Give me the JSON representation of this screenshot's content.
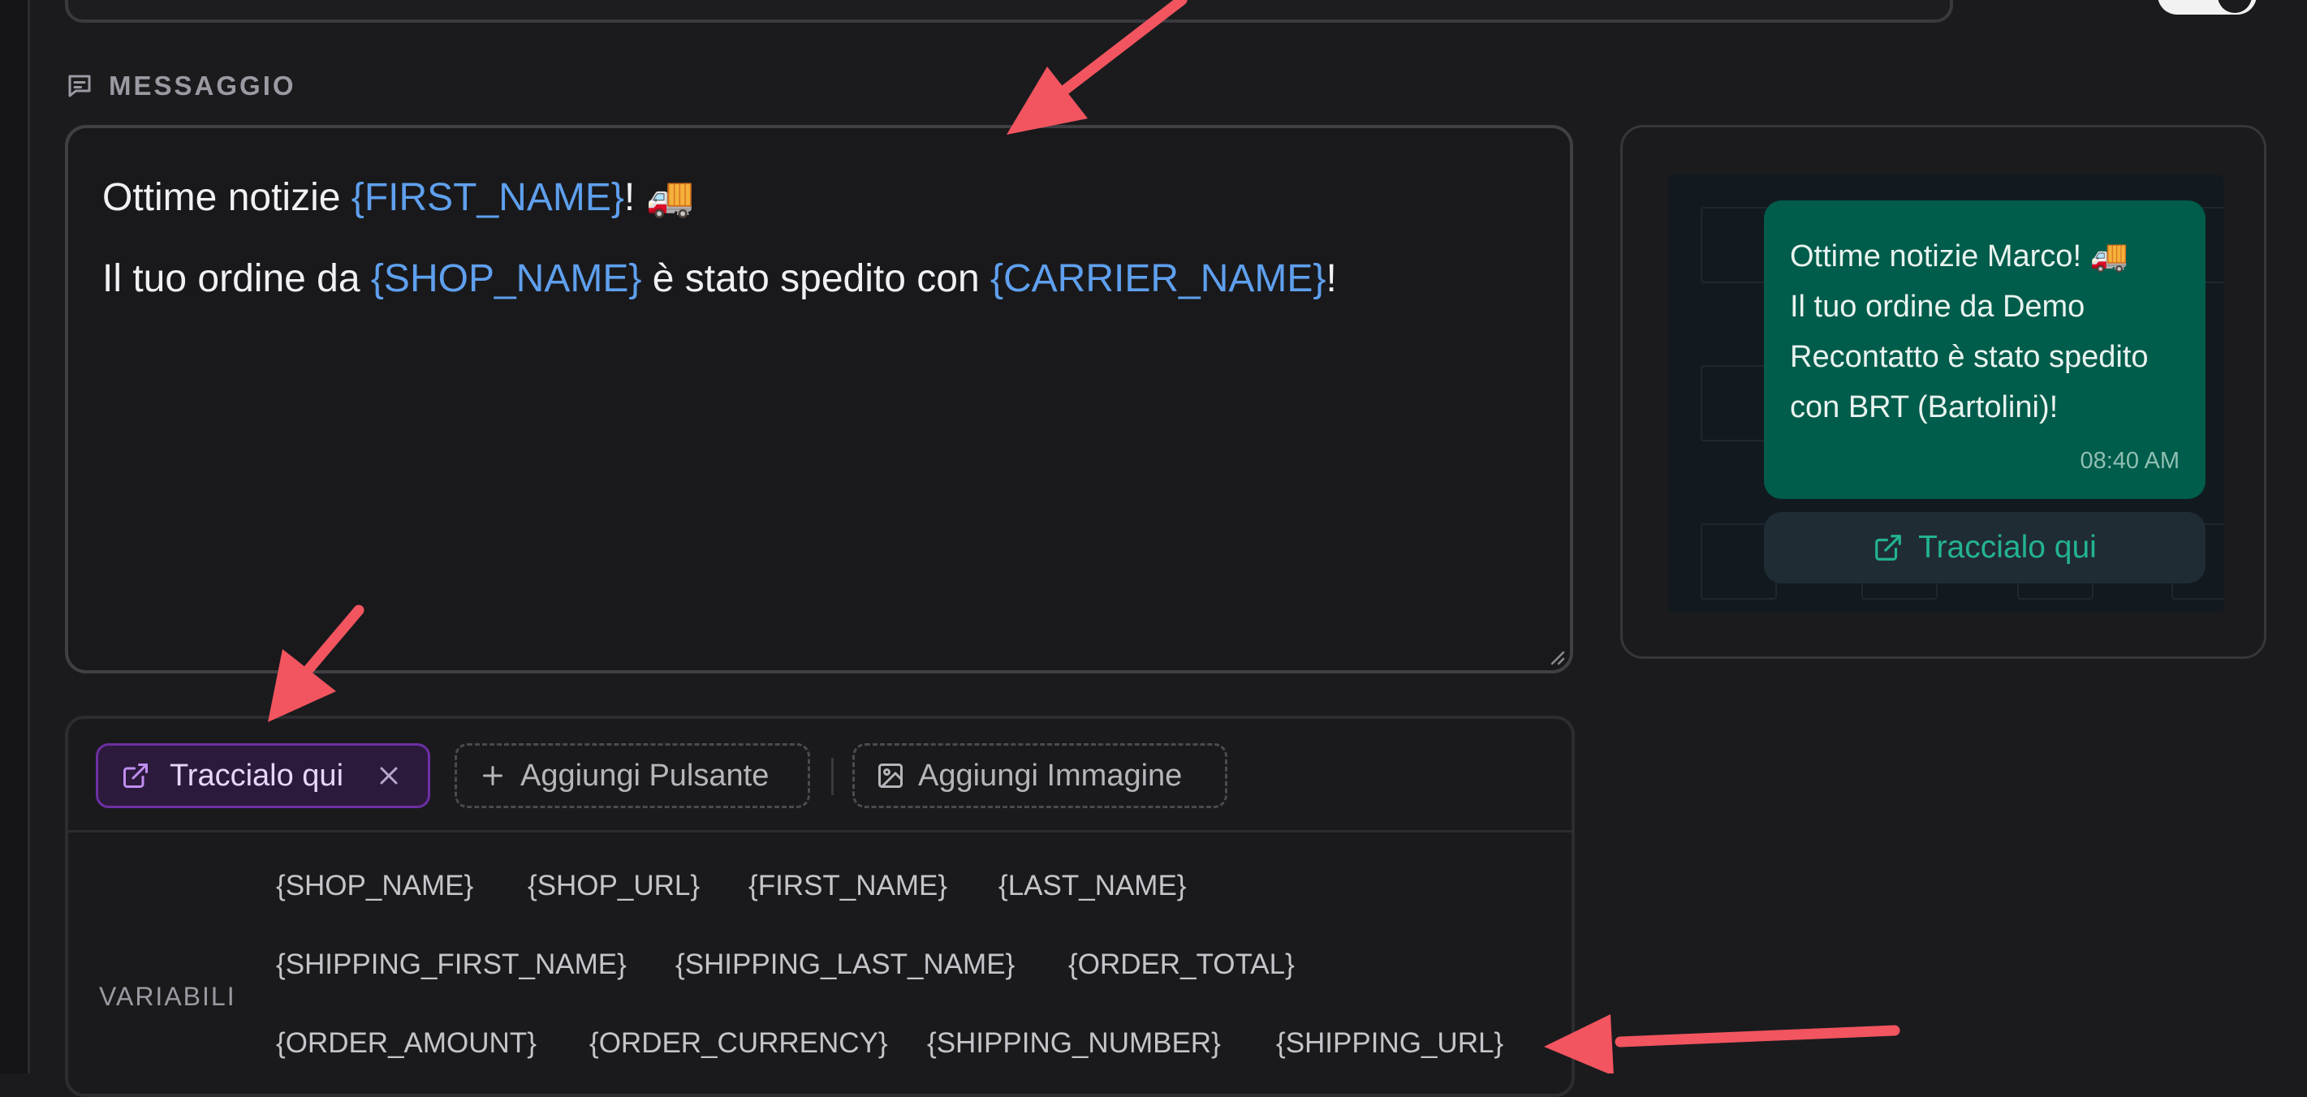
{
  "section": {
    "label": "MESSAGGIO"
  },
  "editor": {
    "line1": {
      "pre": "Ottime notizie ",
      "var": "{FIRST_NAME}",
      "post": "! 🚚"
    },
    "line2": {
      "pre": "Il tuo ordine da ",
      "var1": "{SHOP_NAME}",
      "mid": " è stato spedito con ",
      "var2": "{CARRIER_NAME}",
      "post": "!"
    }
  },
  "preview": {
    "message": "Ottime notizie Marco! 🚚\nIl tuo ordine da Demo Recontatto è stato spedito con BRT (Bartolini)!",
    "message_lines": [
      "Ottime notizie Marco! 🚚",
      "Il tuo ordine da Demo",
      "Recontatto è stato spedito",
      "con BRT (Bartolini)!"
    ],
    "time": "08:40 AM",
    "button_label": "Traccialo qui"
  },
  "toolbar": {
    "active_button_label": "Traccialo qui",
    "add_button_label": "Aggiungi Pulsante",
    "add_image_label": "Aggiungi Immagine"
  },
  "variables": {
    "label": "VARIABILI",
    "rows": [
      [
        "{SHOP_NAME}",
        "{SHOP_URL}",
        "{FIRST_NAME}",
        "{LAST_NAME}"
      ],
      [
        "{SHIPPING_FIRST_NAME}",
        "{SHIPPING_LAST_NAME}",
        "{ORDER_TOTAL}"
      ],
      [
        "{ORDER_AMOUNT}",
        "{ORDER_CURRENCY}",
        "{SHIPPING_NUMBER}",
        "{SHIPPING_URL}"
      ]
    ]
  },
  "colors": {
    "variable": "#5fa0ee",
    "bubble": "#005c4b",
    "cta_text": "#23b392",
    "arrow": "#f2555f",
    "active_chip_border": "#6d2fa3"
  }
}
